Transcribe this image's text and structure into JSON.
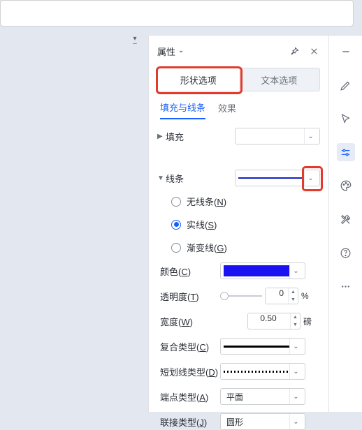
{
  "panel": {
    "title": "属性",
    "tabs": {
      "shape": "形状选项",
      "text": "文本选项"
    },
    "subtabs": {
      "fill_line": "填充与线条",
      "effects": "效果"
    },
    "sections": {
      "fill": "填充",
      "line": "线条"
    }
  },
  "line_radios": {
    "none": "无线条(N)",
    "solid": "实线(S)",
    "gradient": "渐变线(G)"
  },
  "props": {
    "color_label": "颜色(C)",
    "opacity_label": "透明度(T)",
    "opacity_value": "0",
    "opacity_unit": "%",
    "width_label": "宽度(W)",
    "width_value": "0.50",
    "width_unit": "磅",
    "compound_label": "复合类型(C)",
    "dash_label": "短划线类型(D)",
    "cap_label": "端点类型(A)",
    "cap_value": "平面",
    "join_label": "联接类型(J)",
    "join_value": "圆形"
  },
  "colors": {
    "line_preview": "#1020c0",
    "color_value": "#1a12f0"
  }
}
